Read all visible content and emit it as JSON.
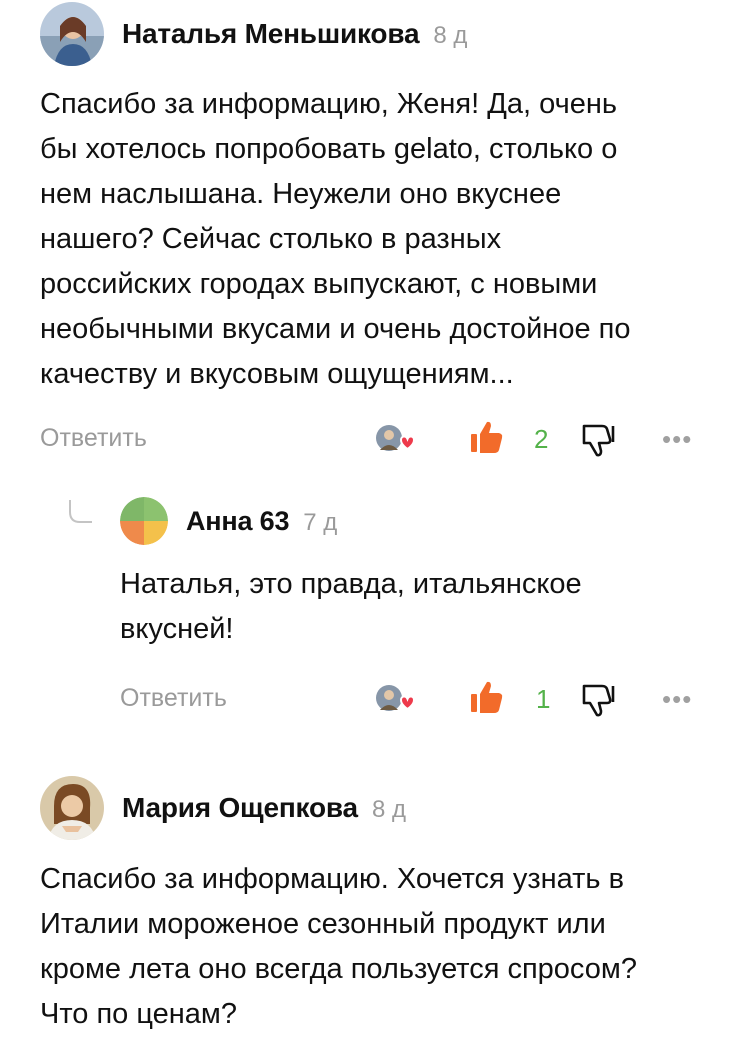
{
  "comments": [
    {
      "author": "Наталья Меньшикова",
      "time": "8 д",
      "text_lines": [
        "Спасибо за информацию, Женя! Да, очень",
        "бы хотелось попробовать gelato, столько о",
        "нем наслышана. Неужели оно вкуснее",
        "нашего? Сейчас столько в разных",
        "российских городах выпускают, с новыми",
        "необычными вкусами и очень достойное по",
        "качеству и вкусовым ощущениям..."
      ],
      "reply_label": "Ответить",
      "likes": "2",
      "reply": {
        "author": "Анна 63",
        "time": "7 д",
        "text_lines": [
          "Наталья, это правда, итальянское",
          "вкусней!"
        ],
        "reply_label": "Ответить",
        "likes": "1"
      }
    },
    {
      "author": "Мария Ощепкова",
      "time": "8 д",
      "text_lines": [
        "Спасибо за информацию. Хочется узнать в",
        "Италии мороженое сезонный продукт или",
        "кроме лета оно всегда пользуется спросом?",
        "Что по ценам?"
      ]
    }
  ],
  "icons": {
    "reactions": "reactions-icon",
    "like": "thumbs-up-icon",
    "dislike": "thumbs-down-icon",
    "more": "more-dots-icon",
    "more_glyph": "•••"
  },
  "colors": {
    "like_orange": "#f26b2a",
    "like_count_green": "#54b24a",
    "muted": "#9a9a9a"
  }
}
